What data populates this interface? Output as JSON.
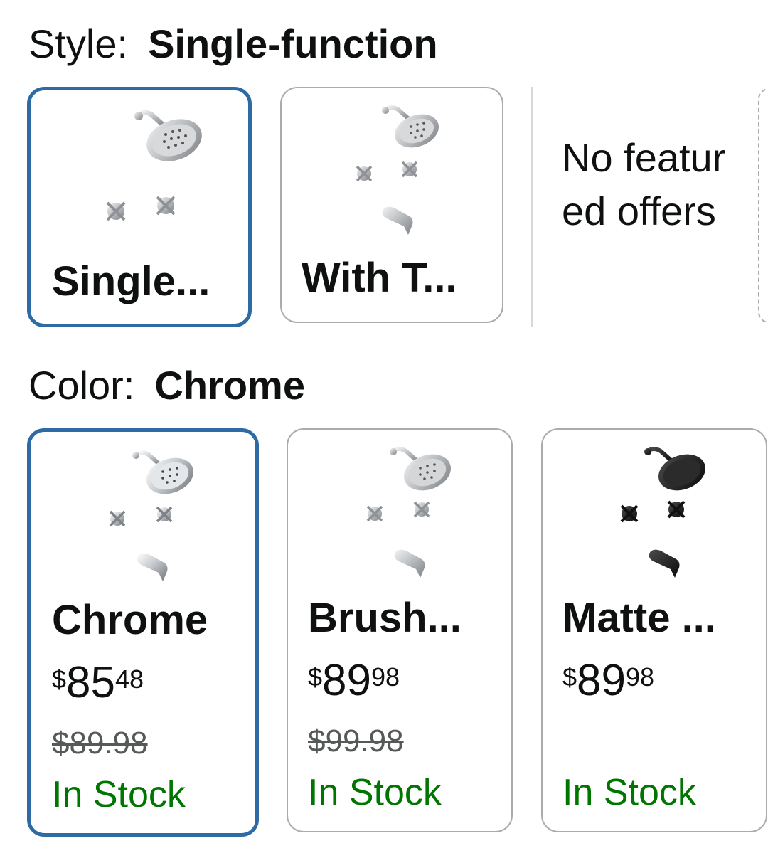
{
  "style": {
    "label": "Style:",
    "selected_value": "Single-function",
    "options": [
      {
        "label": "Single...",
        "selected": true
      },
      {
        "label": "With T...",
        "selected": false
      }
    ],
    "no_featured_text": "No featured offers"
  },
  "color": {
    "label": "Color:",
    "selected_value": "Chrome",
    "options": [
      {
        "label": "Chrome",
        "price_currency": "$",
        "price_whole": "85",
        "price_fraction": "48",
        "list_price": "$89.98",
        "stock": "In Stock",
        "selected": true,
        "finish": "chrome"
      },
      {
        "label": "Brush...",
        "price_currency": "$",
        "price_whole": "89",
        "price_fraction": "98",
        "list_price": "$99.98",
        "stock": "In Stock",
        "selected": false,
        "finish": "brushed-nickel"
      },
      {
        "label": "Matte ...",
        "price_currency": "$",
        "price_whole": "89",
        "price_fraction": "98",
        "list_price": "",
        "stock": "In Stock",
        "selected": false,
        "finish": "matte-black"
      }
    ]
  },
  "colors": {
    "selected_border": "#2e6aa3",
    "in_stock": "#007600",
    "tile_border": "#a9acad",
    "strike_price": "#565959"
  }
}
